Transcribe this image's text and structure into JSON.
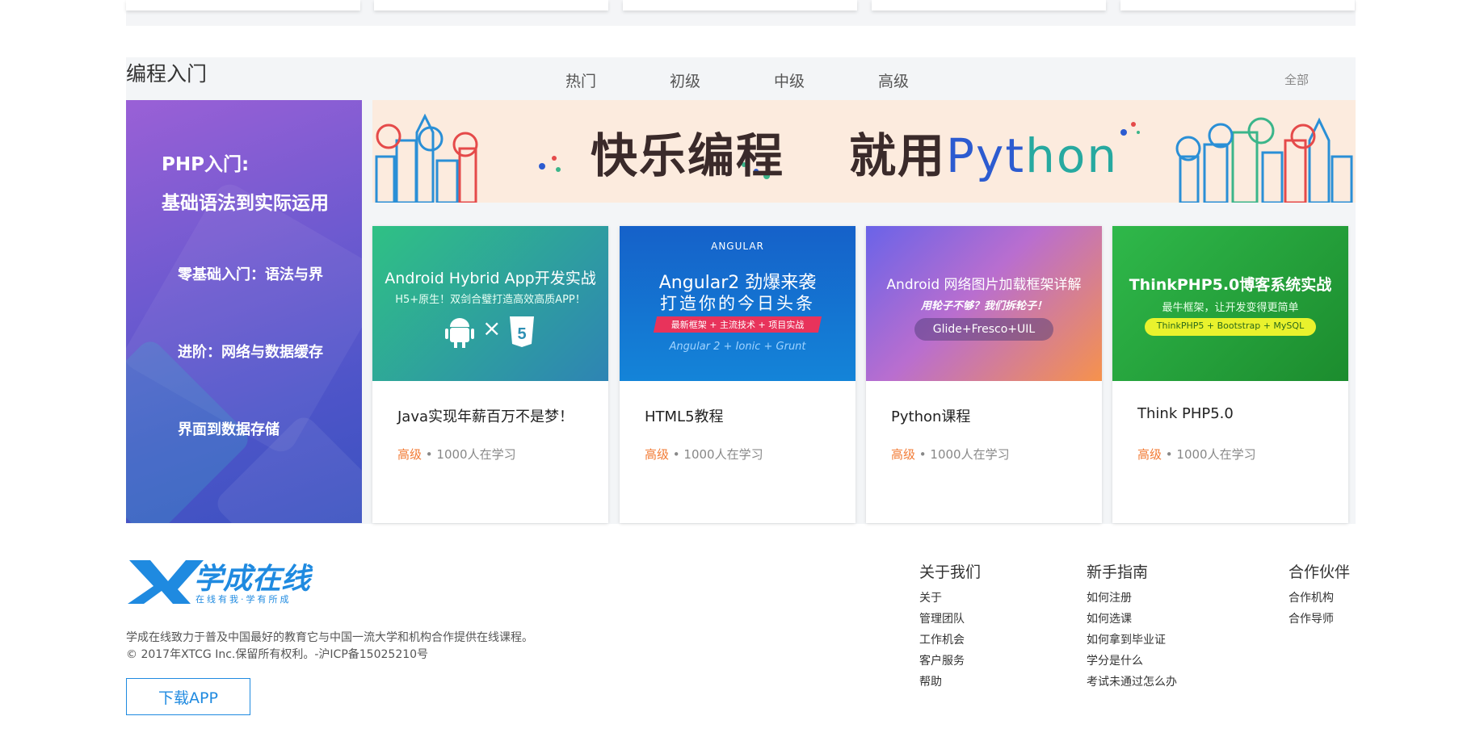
{
  "section": {
    "title": "编程入门",
    "tabs": [
      "热门",
      "初级",
      "中级",
      "高级"
    ],
    "all_label": "全部"
  },
  "promo": {
    "title_line1": "PHP入门:",
    "title_line2": "基础语法到实际运用",
    "items": [
      "零基础入门：语法与界",
      "进阶：网络与数据缓存",
      "界面到数据存储"
    ]
  },
  "banner": {
    "text_cn1": "快乐编程",
    "text_cn2": "就用",
    "text_py1": "Pyt",
    "text_py2": "hon"
  },
  "courses": [
    {
      "image_line1": "Android Hybrid App开发实战",
      "image_line2": "H5+原生！双剑合璧打造高效高质APP！",
      "image_line3": "×",
      "title": "Java实现年薪百万不是梦！",
      "level": "高级",
      "students": "1000人在学习",
      "color": "#2fb48a"
    },
    {
      "image_line1": "Angular2 劲爆来袭",
      "image_line2": "打造你的今日头条",
      "image_line3": "最新框架 + 主流技术 + 项目实战",
      "image_line4": "Angular 2 + Ionic + Grunt",
      "image_badge": "ANGULAR",
      "title": "HTML5教程",
      "level": "高级",
      "students": "1000人在学习",
      "color": "#1769c8"
    },
    {
      "image_line1": "Android 网络图片加载框架详解",
      "image_line2": "用轮子不够？我们拆轮子！",
      "image_line3": "Glide+Fresco+UIL",
      "title": "Python课程",
      "level": "高级",
      "students": "1000人在学习",
      "color": "#b76bd0"
    },
    {
      "image_line1": "ThinkPHP5.0博客系统实战",
      "image_line2": "最牛框架，让开发变得更简单",
      "image_line3": "ThinkPHP5 + Bootstrap + MySQL",
      "title": "Think PHP5.0",
      "level": "高级",
      "students": "1000人在学习",
      "color": "#2aa83a"
    }
  ],
  "footer": {
    "logo_text": "学成在线",
    "logo_slogan": "在线有我·学有所成",
    "description": "学成在线致力于普及中国最好的教育它与中国一流大学和机构合作提供在线课程。",
    "copyright": "© 2017年XTCG Inc.保留所有权利。-沪ICP备15025210号",
    "app_button": "下载APP",
    "columns": [
      {
        "title": "关于我们",
        "links": [
          "关于",
          "管理团队",
          "工作机会",
          "客户服务",
          "帮助"
        ]
      },
      {
        "title": "新手指南",
        "links": [
          "如何注册",
          "如何选课",
          "如何拿到毕业证",
          "学分是什么",
          "考试未通过怎么办"
        ]
      },
      {
        "title": "合作伙伴",
        "links": [
          "合作机构",
          "合作导师"
        ]
      }
    ]
  },
  "colors": {
    "accent": "#1f8ae0",
    "level": "#f27b35",
    "section_bg": "#f3f5f7"
  }
}
